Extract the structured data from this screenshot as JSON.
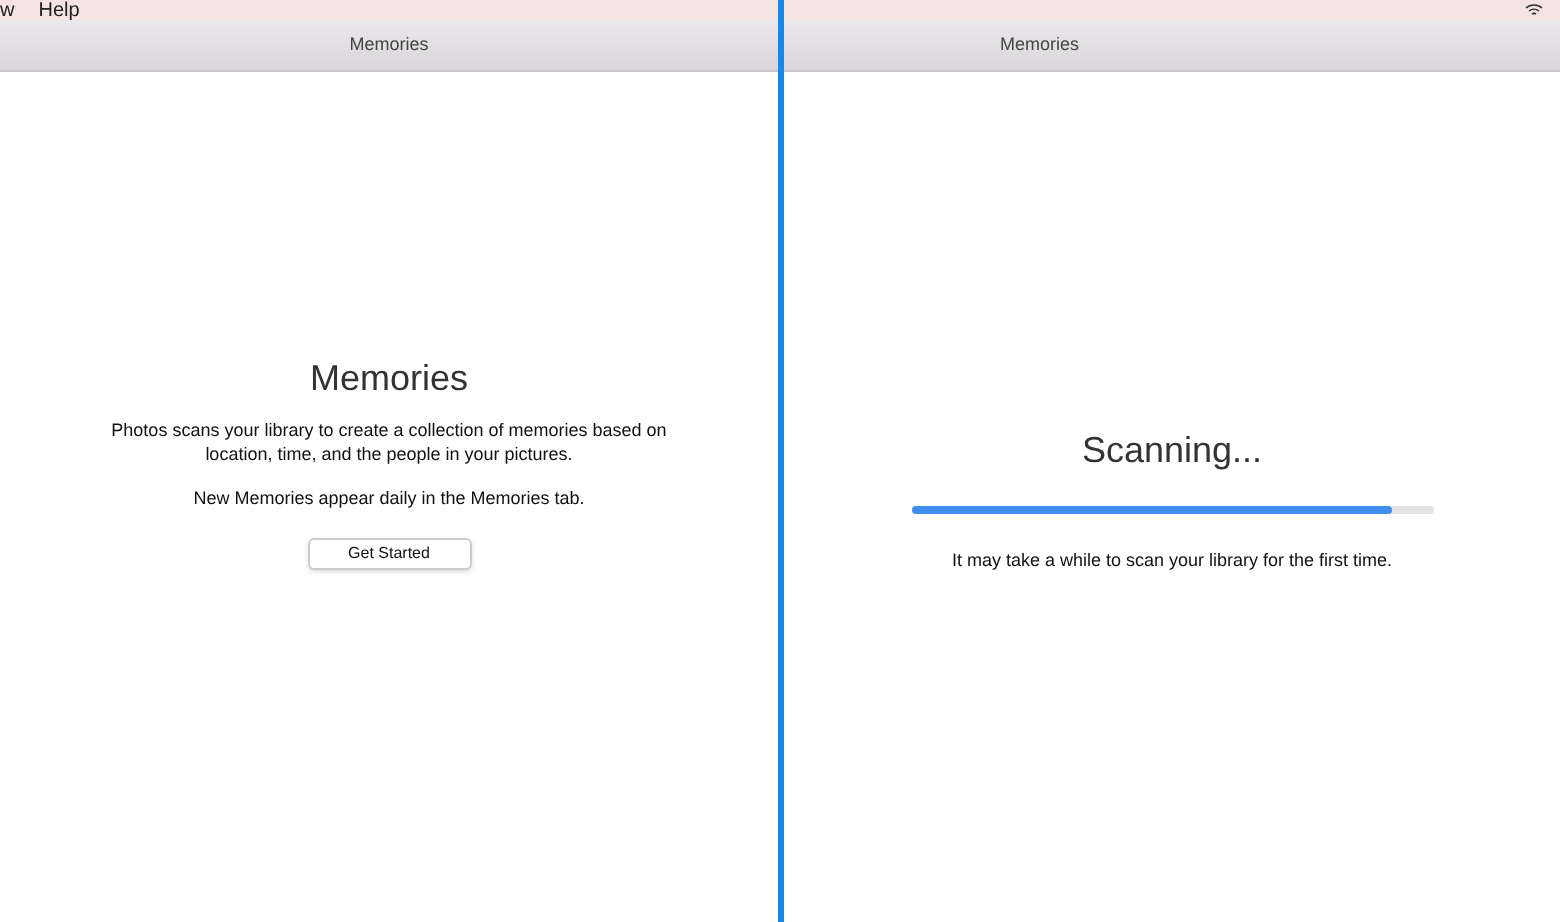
{
  "left": {
    "menu_bar": [
      "w",
      "Help"
    ],
    "title": "Memories",
    "heading": "Memories",
    "description": "Photos scans your library to create a collection of memories based on location, time, and the people in your pictures.",
    "note": "New Memories appear daily in the Memories tab.",
    "button": "Get Started"
  },
  "right": {
    "title": "Memories",
    "heading": "Scanning...",
    "progress": {
      "level": 0.92
    },
    "note": "It may take a while to scan your library for the first time."
  }
}
